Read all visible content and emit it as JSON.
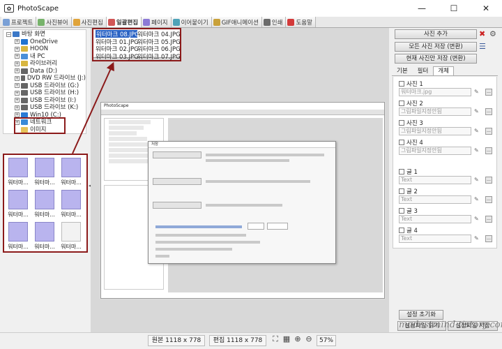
{
  "app": {
    "title": "PhotoScape",
    "window_controls": [
      "—",
      "☐",
      "✕"
    ]
  },
  "tabs": [
    {
      "label": "프로젝트",
      "color": "#7aa0d6"
    },
    {
      "label": "사진뷰어",
      "color": "#77b36b"
    },
    {
      "label": "사진편집",
      "color": "#e0a43b"
    },
    {
      "label": "일괄편집",
      "color": "#d15656",
      "active": true
    },
    {
      "label": "페이지",
      "color": "#8c7ad6"
    },
    {
      "label": "이어붙이기",
      "color": "#4fa3b8"
    },
    {
      "label": "GIF애니메이션",
      "color": "#c9a13a"
    },
    {
      "label": "인쇄",
      "color": "#6b6b6b"
    },
    {
      "label": "도움말",
      "color": "#d33a3a"
    }
  ],
  "tree": [
    {
      "label": "바탕 화면",
      "indent": 0,
      "exp": "−"
    },
    {
      "label": "OneDrive",
      "indent": 1,
      "exp": "+"
    },
    {
      "label": "HOON",
      "indent": 1,
      "exp": "+"
    },
    {
      "label": "내 PC",
      "indent": 1,
      "exp": "+"
    },
    {
      "label": "라이브러리",
      "indent": 1,
      "exp": "+"
    },
    {
      "label": "Data (D:)",
      "indent": 1,
      "exp": "+"
    },
    {
      "label": "DVD RW 드라이브 (J:)",
      "indent": 1,
      "exp": "+"
    },
    {
      "label": "USB 드라이브 (G:)",
      "indent": 1,
      "exp": "+"
    },
    {
      "label": "USB 드라이브 (H:)",
      "indent": 1,
      "exp": "+"
    },
    {
      "label": "USB 드라이브 (I:)",
      "indent": 1,
      "exp": "+"
    },
    {
      "label": "USB 드라이브 (K:)",
      "indent": 1,
      "exp": "+"
    },
    {
      "label": "Win10 (C:)",
      "indent": 1,
      "exp": "+"
    },
    {
      "label": "네트워크",
      "indent": 1,
      "exp": "+"
    },
    {
      "label": "이미지",
      "indent": 1,
      "exp": ""
    }
  ],
  "thumbs": [
    {
      "caption": "워터마..."
    },
    {
      "caption": "워터마..."
    },
    {
      "caption": "워터마..."
    },
    {
      "caption": "워터마..."
    },
    {
      "caption": "워터마..."
    },
    {
      "caption": "워터마..."
    },
    {
      "caption": "워터마..."
    },
    {
      "caption": "워터마..."
    },
    {
      "caption": "워터마..."
    }
  ],
  "files": [
    {
      "name": "워터마크 08.JPG",
      "selected": true
    },
    {
      "name": "워터마크 04.JPG"
    },
    {
      "name": "워터마크 01.JPG"
    },
    {
      "name": "워터마크 05.JPG"
    },
    {
      "name": "워터마크 02.JPG"
    },
    {
      "name": "워터마크 06.JPG"
    },
    {
      "name": "워터마크 03.JPG"
    },
    {
      "name": "워터마크 07.JPG"
    }
  ],
  "inner_screenshot": {
    "title": "PhotoScape",
    "dialog_title": "저장"
  },
  "right": {
    "add_button": "사진 추가",
    "save_all_button": "모든 사진 저장 (변환)",
    "save_current_button": "현재 사진만 저장 (변환)",
    "tabs": [
      "기본",
      "필터",
      "개체"
    ],
    "photo_items": [
      {
        "label": "사진 1",
        "value": "워터마크.jpg"
      },
      {
        "label": "사진 2",
        "value": "그림파일지정안됨"
      },
      {
        "label": "사진 3",
        "value": "그림파일지정안됨"
      },
      {
        "label": "사진 4",
        "value": "그림파일지정안됨"
      }
    ],
    "text_items": [
      {
        "label": "글 1",
        "placeholder": "Text"
      },
      {
        "label": "글 2",
        "placeholder": "Text"
      },
      {
        "label": "글 3",
        "placeholder": "Text"
      },
      {
        "label": "글 4",
        "placeholder": "Text"
      }
    ],
    "load_button": "설정파일 읽기",
    "save_button": "설정파일 저장",
    "reset_button": "설정 초기화"
  },
  "status": {
    "original": "원본 1118 x 778",
    "edited": "편집 1118 x 778",
    "zoom": "57%"
  },
  "watermark": "modestmind.tistory.com"
}
